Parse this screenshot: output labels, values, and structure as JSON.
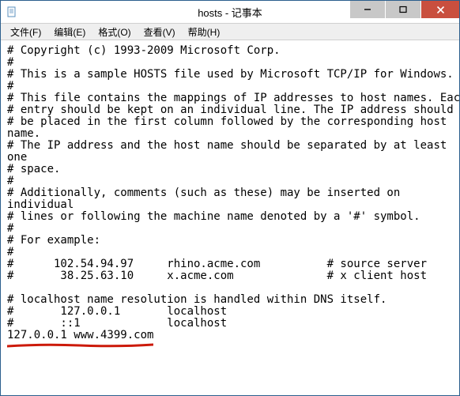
{
  "window": {
    "title": "hosts - 记事本"
  },
  "menu": {
    "file": "文件(F)",
    "edit": "编辑(E)",
    "format": "格式(O)",
    "view": "查看(V)",
    "help": "帮助(H)"
  },
  "content": {
    "text": "# Copyright (c) 1993-2009 Microsoft Corp.\n#\n# This is a sample HOSTS file used by Microsoft TCP/IP for Windows.\n#\n# This file contains the mappings of IP addresses to host names. Each\n# entry should be kept on an individual line. The IP address should\n# be placed in the first column followed by the corresponding host\nname.\n# The IP address and the host name should be separated by at least\none\n# space.\n#\n# Additionally, comments (such as these) may be inserted on\nindividual\n# lines or following the machine name denoted by a '#' symbol.\n#\n# For example:\n#\n#      102.54.94.97     rhino.acme.com          # source server\n#       38.25.63.10     x.acme.com              # x client host\n\n# localhost name resolution is handled within DNS itself.\n#       127.0.0.1       localhost\n#       ::1             localhost\n127.0.0.1 www.4399.com\n"
  }
}
